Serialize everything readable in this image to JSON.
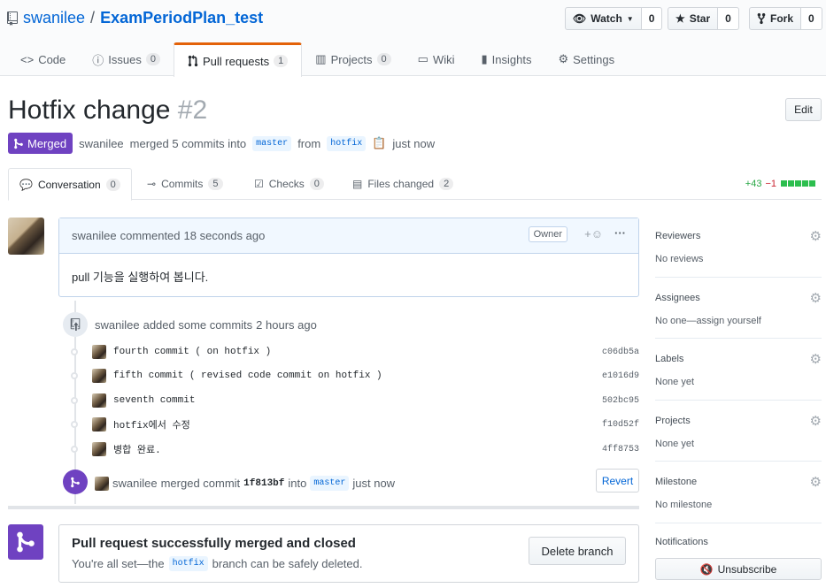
{
  "repo": {
    "owner": "swanilee",
    "separator": "/",
    "name": "ExamPeriodPlan_test"
  },
  "actions": {
    "watch": {
      "label": "Watch",
      "count": "0"
    },
    "star": {
      "label": "Star",
      "count": "0"
    },
    "fork": {
      "label": "Fork",
      "count": "0"
    }
  },
  "nav": [
    {
      "label": "Code"
    },
    {
      "label": "Issues",
      "count": "0"
    },
    {
      "label": "Pull requests",
      "count": "1"
    },
    {
      "label": "Projects",
      "count": "0"
    },
    {
      "label": "Wiki"
    },
    {
      "label": "Insights"
    },
    {
      "label": "Settings"
    }
  ],
  "pr": {
    "title": "Hotfix change",
    "number": "#2",
    "edit_label": "Edit",
    "state": "Merged",
    "author": "swanilee",
    "merge_text": "merged 5 commits into",
    "base_branch": "master",
    "from_text": "from",
    "head_branch": "hotfix",
    "time": "just now"
  },
  "tabs": [
    {
      "label": "Conversation",
      "count": "0"
    },
    {
      "label": "Commits",
      "count": "5"
    },
    {
      "label": "Checks",
      "count": "0"
    },
    {
      "label": "Files changed",
      "count": "2"
    }
  ],
  "diffstat": {
    "additions": "+43",
    "deletions": "−1"
  },
  "comment": {
    "author": "swanilee",
    "action": "commented",
    "time": "18 seconds ago",
    "role": "Owner",
    "body": "pull 기능을 실행하여 봅니다."
  },
  "commits_event": {
    "author": "swanilee",
    "text": "added some commits",
    "time": "2 hours ago"
  },
  "commits": [
    {
      "message": "fourth commit ( on hotfix )",
      "sha": "c06db5a"
    },
    {
      "message": "fifth commit ( revised code commit on hotfix )",
      "sha": "e1016d9"
    },
    {
      "message": "seventh commit",
      "sha": "502bc95"
    },
    {
      "message": "hotfix에서 수정",
      "sha": "f10d52f"
    },
    {
      "message": "병합 완료.",
      "sha": "4ff8753"
    }
  ],
  "merge_event": {
    "author": "swanilee",
    "text": "merged commit",
    "sha": "1f813bf",
    "into": "into",
    "branch": "master",
    "time": "just now",
    "revert_label": "Revert"
  },
  "merge_box": {
    "title": "Pull request successfully merged and closed",
    "text_before": "You're all set—the",
    "branch": "hotfix",
    "text_after": "branch can be safely deleted.",
    "delete_label": "Delete branch"
  },
  "sidebar": {
    "reviewers": {
      "label": "Reviewers",
      "value": "No reviews"
    },
    "assignees": {
      "label": "Assignees",
      "value": "No one—assign yourself"
    },
    "labels": {
      "label": "Labels",
      "value": "None yet"
    },
    "projects": {
      "label": "Projects",
      "value": "None yet"
    },
    "milestone": {
      "label": "Milestone",
      "value": "No milestone"
    },
    "notifications": {
      "label": "Notifications",
      "unsubscribe": "Unsubscribe"
    }
  },
  "colors": {
    "merged": "#6f42c1",
    "link": "#0366d6",
    "accent_tab": "#e36209",
    "diff_add": "#28a745",
    "diff_del": "#cb2431"
  }
}
